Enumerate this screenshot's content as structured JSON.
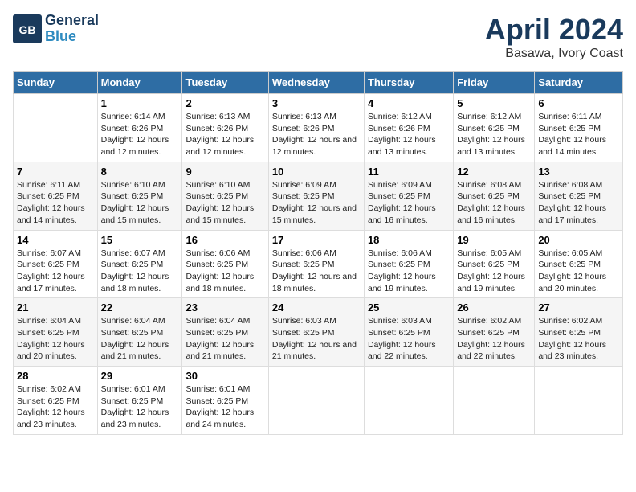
{
  "header": {
    "logo_line1": "General",
    "logo_line2": "Blue",
    "month": "April 2024",
    "location": "Basawa, Ivory Coast"
  },
  "weekdays": [
    "Sunday",
    "Monday",
    "Tuesday",
    "Wednesday",
    "Thursday",
    "Friday",
    "Saturday"
  ],
  "weeks": [
    [
      {
        "num": "",
        "sunrise": "",
        "sunset": "",
        "daylight": ""
      },
      {
        "num": "1",
        "sunrise": "6:14 AM",
        "sunset": "6:26 PM",
        "daylight": "12 hours and 12 minutes."
      },
      {
        "num": "2",
        "sunrise": "6:13 AM",
        "sunset": "6:26 PM",
        "daylight": "12 hours and 12 minutes."
      },
      {
        "num": "3",
        "sunrise": "6:13 AM",
        "sunset": "6:26 PM",
        "daylight": "12 hours and 12 minutes."
      },
      {
        "num": "4",
        "sunrise": "6:12 AM",
        "sunset": "6:26 PM",
        "daylight": "12 hours and 13 minutes."
      },
      {
        "num": "5",
        "sunrise": "6:12 AM",
        "sunset": "6:25 PM",
        "daylight": "12 hours and 13 minutes."
      },
      {
        "num": "6",
        "sunrise": "6:11 AM",
        "sunset": "6:25 PM",
        "daylight": "12 hours and 14 minutes."
      }
    ],
    [
      {
        "num": "7",
        "sunrise": "6:11 AM",
        "sunset": "6:25 PM",
        "daylight": "12 hours and 14 minutes."
      },
      {
        "num": "8",
        "sunrise": "6:10 AM",
        "sunset": "6:25 PM",
        "daylight": "12 hours and 15 minutes."
      },
      {
        "num": "9",
        "sunrise": "6:10 AM",
        "sunset": "6:25 PM",
        "daylight": "12 hours and 15 minutes."
      },
      {
        "num": "10",
        "sunrise": "6:09 AM",
        "sunset": "6:25 PM",
        "daylight": "12 hours and 15 minutes."
      },
      {
        "num": "11",
        "sunrise": "6:09 AM",
        "sunset": "6:25 PM",
        "daylight": "12 hours and 16 minutes."
      },
      {
        "num": "12",
        "sunrise": "6:08 AM",
        "sunset": "6:25 PM",
        "daylight": "12 hours and 16 minutes."
      },
      {
        "num": "13",
        "sunrise": "6:08 AM",
        "sunset": "6:25 PM",
        "daylight": "12 hours and 17 minutes."
      }
    ],
    [
      {
        "num": "14",
        "sunrise": "6:07 AM",
        "sunset": "6:25 PM",
        "daylight": "12 hours and 17 minutes."
      },
      {
        "num": "15",
        "sunrise": "6:07 AM",
        "sunset": "6:25 PM",
        "daylight": "12 hours and 18 minutes."
      },
      {
        "num": "16",
        "sunrise": "6:06 AM",
        "sunset": "6:25 PM",
        "daylight": "12 hours and 18 minutes."
      },
      {
        "num": "17",
        "sunrise": "6:06 AM",
        "sunset": "6:25 PM",
        "daylight": "12 hours and 18 minutes."
      },
      {
        "num": "18",
        "sunrise": "6:06 AM",
        "sunset": "6:25 PM",
        "daylight": "12 hours and 19 minutes."
      },
      {
        "num": "19",
        "sunrise": "6:05 AM",
        "sunset": "6:25 PM",
        "daylight": "12 hours and 19 minutes."
      },
      {
        "num": "20",
        "sunrise": "6:05 AM",
        "sunset": "6:25 PM",
        "daylight": "12 hours and 20 minutes."
      }
    ],
    [
      {
        "num": "21",
        "sunrise": "6:04 AM",
        "sunset": "6:25 PM",
        "daylight": "12 hours and 20 minutes."
      },
      {
        "num": "22",
        "sunrise": "6:04 AM",
        "sunset": "6:25 PM",
        "daylight": "12 hours and 21 minutes."
      },
      {
        "num": "23",
        "sunrise": "6:04 AM",
        "sunset": "6:25 PM",
        "daylight": "12 hours and 21 minutes."
      },
      {
        "num": "24",
        "sunrise": "6:03 AM",
        "sunset": "6:25 PM",
        "daylight": "12 hours and 21 minutes."
      },
      {
        "num": "25",
        "sunrise": "6:03 AM",
        "sunset": "6:25 PM",
        "daylight": "12 hours and 22 minutes."
      },
      {
        "num": "26",
        "sunrise": "6:02 AM",
        "sunset": "6:25 PM",
        "daylight": "12 hours and 22 minutes."
      },
      {
        "num": "27",
        "sunrise": "6:02 AM",
        "sunset": "6:25 PM",
        "daylight": "12 hours and 23 minutes."
      }
    ],
    [
      {
        "num": "28",
        "sunrise": "6:02 AM",
        "sunset": "6:25 PM",
        "daylight": "12 hours and 23 minutes."
      },
      {
        "num": "29",
        "sunrise": "6:01 AM",
        "sunset": "6:25 PM",
        "daylight": "12 hours and 23 minutes."
      },
      {
        "num": "30",
        "sunrise": "6:01 AM",
        "sunset": "6:25 PM",
        "daylight": "12 hours and 24 minutes."
      },
      {
        "num": "",
        "sunrise": "",
        "sunset": "",
        "daylight": ""
      },
      {
        "num": "",
        "sunrise": "",
        "sunset": "",
        "daylight": ""
      },
      {
        "num": "",
        "sunrise": "",
        "sunset": "",
        "daylight": ""
      },
      {
        "num": "",
        "sunrise": "",
        "sunset": "",
        "daylight": ""
      }
    ]
  ]
}
